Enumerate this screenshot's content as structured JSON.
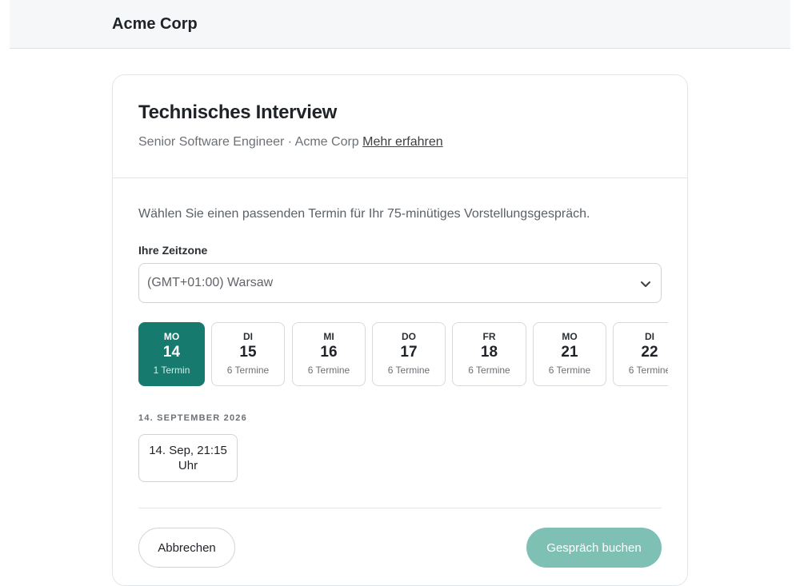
{
  "header": {
    "brand": "Acme Corp"
  },
  "event": {
    "title": "Technisches Interview",
    "subtitle": "Senior Software Engineer · Acme Corp",
    "learn_more": "Mehr erfahren",
    "intro": "Wählen Sie einen passenden Termin für Ihr 75-minütiges Vorstellungsgespräch."
  },
  "timezone": {
    "label": "Ihre Zeitzone",
    "value": "(GMT+01:00) Warsaw",
    "icon": "chevron-down-icon"
  },
  "days": [
    {
      "dow": "MO",
      "num": "14",
      "count": "1 Termin",
      "selected": true
    },
    {
      "dow": "DI",
      "num": "15",
      "count": "6 Termine",
      "selected": false
    },
    {
      "dow": "MI",
      "num": "16",
      "count": "6 Termine",
      "selected": false
    },
    {
      "dow": "DO",
      "num": "17",
      "count": "6 Termine",
      "selected": false
    },
    {
      "dow": "FR",
      "num": "18",
      "count": "6 Termine",
      "selected": false
    },
    {
      "dow": "MO",
      "num": "21",
      "count": "6 Termine",
      "selected": false
    },
    {
      "dow": "DI",
      "num": "22",
      "count": "6 Termine",
      "selected": false
    }
  ],
  "selected_date": {
    "heading": "14. SEPTEMBER 2026"
  },
  "slots": [
    {
      "label": "14. Sep, 21:15 Uhr"
    }
  ],
  "actions": {
    "cancel": "Abbrechen",
    "book": "Gespräch buchen"
  },
  "colors": {
    "accent": "#177a6e",
    "book_button_disabled": "#7fc0b4"
  }
}
